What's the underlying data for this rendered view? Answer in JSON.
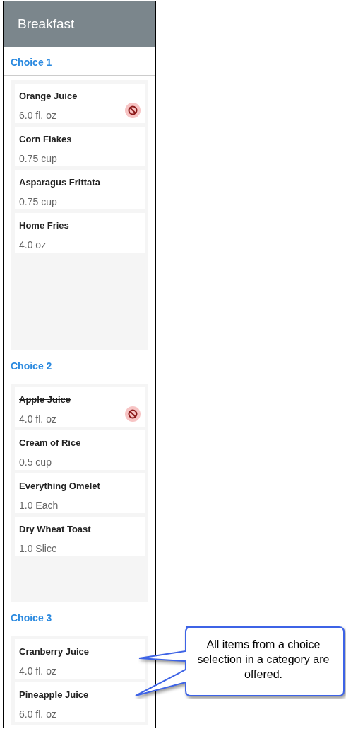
{
  "header": {
    "title": "Breakfast"
  },
  "choices": [
    {
      "label": "Choice 1",
      "items": [
        {
          "name": "Orange Juice",
          "amount": "6.0 fl. oz",
          "unavailable": true
        },
        {
          "name": "Corn Flakes",
          "amount": "0.75 cup",
          "unavailable": false
        },
        {
          "name": "Asparagus Frittata",
          "amount": "0.75 cup",
          "unavailable": false
        },
        {
          "name": "Home Fries",
          "amount": "4.0 oz",
          "unavailable": false
        }
      ]
    },
    {
      "label": "Choice 2",
      "items": [
        {
          "name": "Apple Juice",
          "amount": "4.0 fl. oz",
          "unavailable": true
        },
        {
          "name": "Cream of Rice",
          "amount": "0.5 cup",
          "unavailable": false
        },
        {
          "name": "Everything Omelet",
          "amount": "1.0 Each",
          "unavailable": false
        },
        {
          "name": "Dry Wheat Toast",
          "amount": "1.0 Slice",
          "unavailable": false
        }
      ]
    },
    {
      "label": "Choice 3",
      "items": [
        {
          "name": "Cranberry Juice",
          "amount": "4.0 fl. oz",
          "unavailable": false
        },
        {
          "name": "Pineapple Juice",
          "amount": "6.0 fl. oz",
          "unavailable": false
        }
      ]
    }
  ],
  "callout": {
    "text": "All items from a choice selection in a category are offered."
  }
}
